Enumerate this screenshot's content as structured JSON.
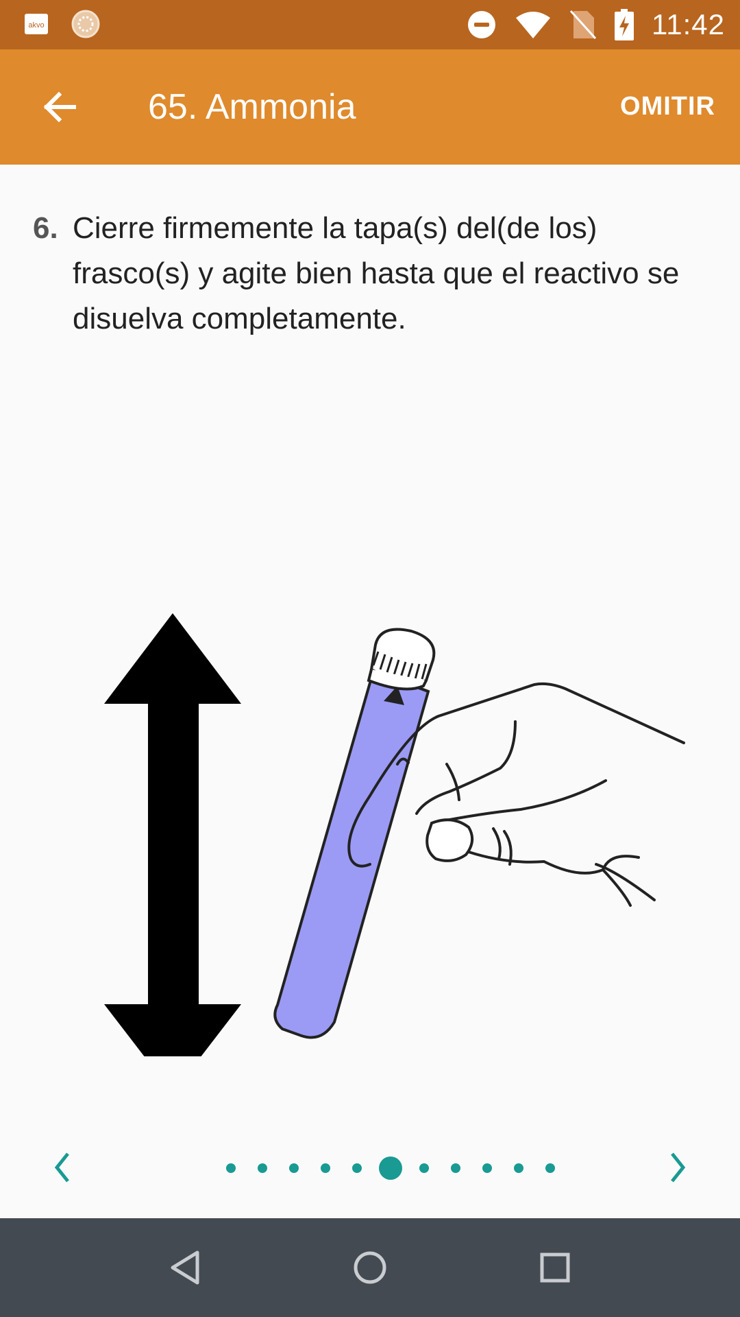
{
  "status_bar": {
    "time": "11:42",
    "icons": [
      "akvo-app-icon",
      "app-logo-icon",
      "do-not-disturb-icon",
      "wifi-icon",
      "no-sim-icon",
      "battery-charging-icon"
    ],
    "akvo_logo_text": "akvo"
  },
  "app_bar": {
    "title": "65. Ammonia",
    "skip_label": "OMITIR",
    "back_icon": "arrow-back-icon"
  },
  "step": {
    "number": "6.",
    "text": "Cierre firmemente la tapa(s) del(de los) frasco(s) y agite bien hasta que el reactivo se disuelva completamente."
  },
  "pager": {
    "total_pages": 11,
    "current_page": 6,
    "prev_icon": "chevron-left-icon",
    "next_icon": "chevron-right-icon"
  },
  "system_nav": {
    "buttons": [
      "back-triangle-icon",
      "home-circle-icon",
      "recents-square-icon"
    ]
  },
  "colors": {
    "status_bar": "#b8651f",
    "app_bar": "#df8a2c",
    "accent": "#199a93",
    "vial": "#9b9bf5",
    "nav_bar": "#434a51"
  }
}
